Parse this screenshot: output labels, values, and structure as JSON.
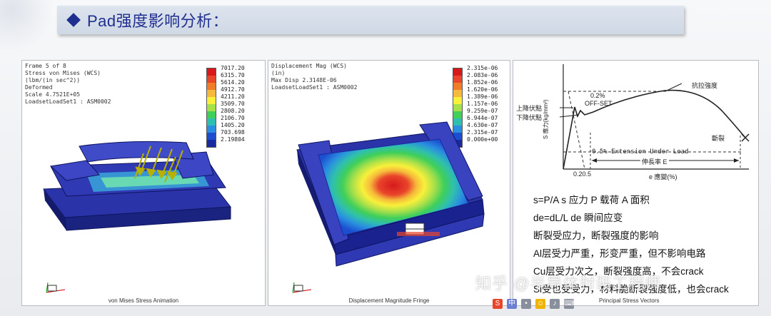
{
  "slide": {
    "title": "Pad强度影响分析："
  },
  "panel1": {
    "info": [
      "Frame 5 of 8",
      "Stress von Mises (WCS)",
      "(lbm/(in sec^2))",
      "Deformed",
      "Scale  4.7521E+05",
      "LoadsetLoadSet1 : ASM0002"
    ],
    "legend_values": [
      "7017.20",
      "6315.70",
      "5614.20",
      "4912.70",
      "4211.20",
      "3509.70",
      "2808.20",
      "2106.70",
      "1405.20",
      "703.698",
      "2.19804"
    ],
    "caption": "von Mises Stress Animation"
  },
  "panel2": {
    "info": [
      "Displacement Mag (WCS)",
      "(in)",
      "Max Disp  2.3148E-06",
      "LoadsetLoadSet1 : ASM0002"
    ],
    "legend_values": [
      "2.315e-06",
      "2.083e-06",
      "1.852e-06",
      "1.620e-06",
      "1.389e-06",
      "1.157e-06",
      "9.259e-07",
      "6.944e-07",
      "4.630e-07",
      "2.315e-07",
      "0.000e+00"
    ],
    "caption": "Displacement Magnitude Fringe"
  },
  "panel3": {
    "labels": {
      "offset_pct": "0.2%",
      "offset": "OFF-SET",
      "tensile": "抗拉強度",
      "upper_yield": "上降伏點",
      "lower_yield": "下降伏點",
      "fracture": "斷裂",
      "extension": "0.5%  Extension  Under  Load",
      "elongation": "伸長率 E",
      "y_axis": "S 應力(kg/mm²)",
      "x_axis": "e 應變(%)",
      "x_ticks": "0.20.5"
    },
    "text_lines": [
      "s=P/A       s 应力  P 载荷  A 面积",
      "de=dL/L   de 瞬间应变",
      "断裂受应力，断裂强度的影响",
      "Al层受力严重，形变严重，但不影响电路",
      "Cu层受力次之，断裂强度高，不会crack",
      "Si受也受受力，材料脆断裂强度低，也会crack"
    ],
    "bottom_caption": "Principal Stress Vectors"
  },
  "overlay": {
    "watermark": "知乎 @半导体封装工程师"
  },
  "colors": {
    "title_text": "#1f2f8f",
    "title_bar": "#d4dce8",
    "fringe": [
      "#d7191c",
      "#e8452b",
      "#f07c2a",
      "#f6b93b",
      "#f9f03a",
      "#a8e04a",
      "#3fcf5a",
      "#2fbfb0",
      "#2a8fe0",
      "#1b4fd0",
      "#1a2a9e"
    ]
  }
}
